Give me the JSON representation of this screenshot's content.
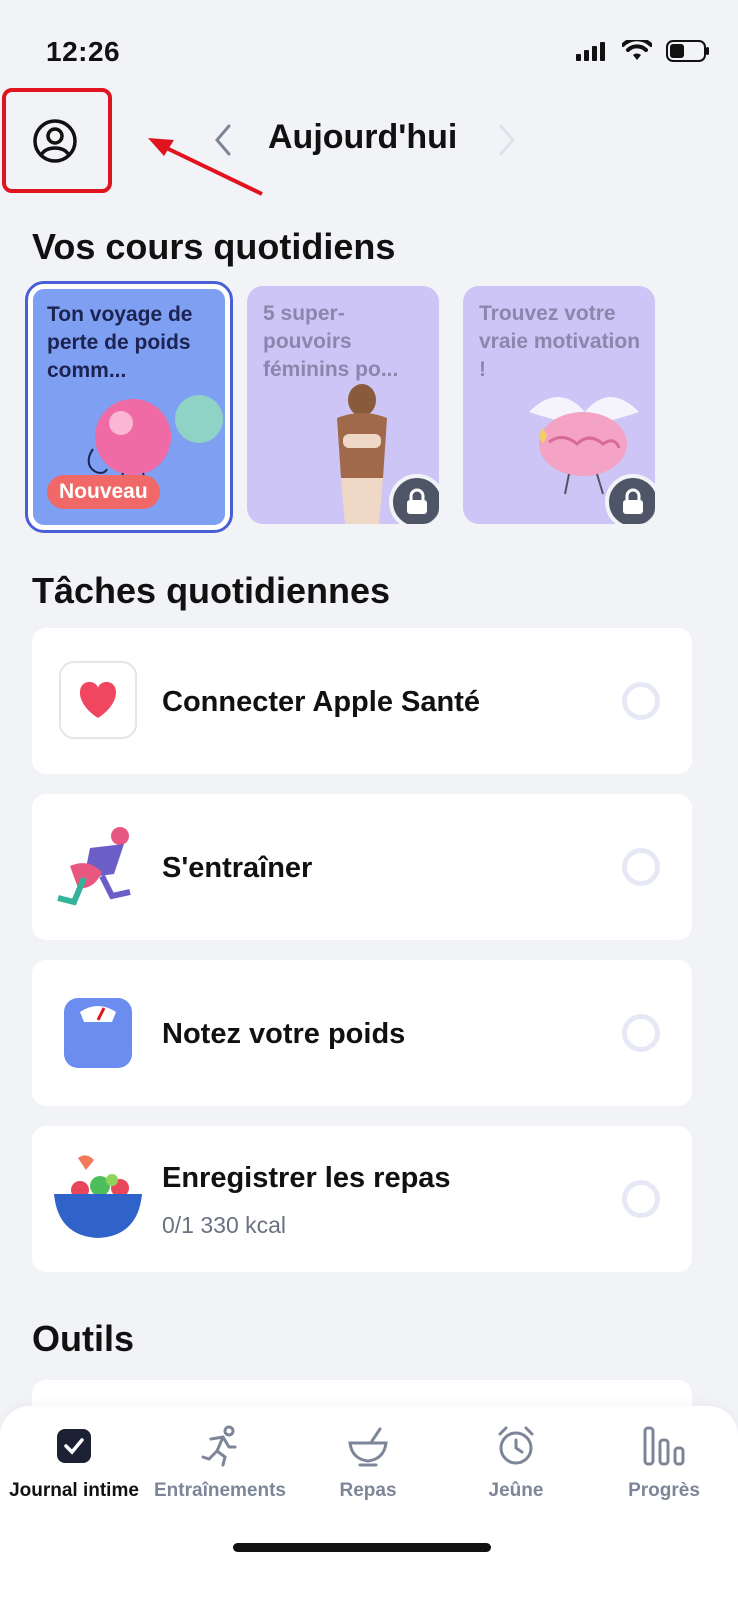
{
  "status_bar": {
    "time": "12:26"
  },
  "header": {
    "title": "Aujourd'hui"
  },
  "courses": {
    "section_title": "Vos cours quotidiens",
    "items": [
      {
        "title": "Ton voyage de perte de poids comm...",
        "badge": "Nouveau",
        "locked": false
      },
      {
        "title": "5 super-pouvoirs féminins po...",
        "locked": true
      },
      {
        "title": "Trouvez votre vraie motivation !",
        "locked": true
      }
    ]
  },
  "tasks": {
    "section_title": "Tâches quotidiennes",
    "items": [
      {
        "label": "Connecter Apple Santé",
        "icon": "heart-icon"
      },
      {
        "label": "S'entraîner",
        "icon": "runner-icon"
      },
      {
        "label": "Notez votre poids",
        "icon": "scale-icon"
      },
      {
        "label": "Enregistrer les repas",
        "sub": "0/1 330 kcal",
        "icon": "salad-bowl-icon"
      }
    ]
  },
  "tools": {
    "section_title": "Outils"
  },
  "tabbar": {
    "tabs": [
      {
        "label": "Journal intime",
        "icon": "journal-check-icon",
        "active": true
      },
      {
        "label": "Entraînements",
        "icon": "runner-icon"
      },
      {
        "label": "Repas",
        "icon": "bowl-icon"
      },
      {
        "label": "Jeûne",
        "icon": "alarm-clock-icon"
      },
      {
        "label": "Progrès",
        "icon": "bar-chart-icon"
      }
    ]
  },
  "colors": {
    "accent": "#4a5fd6",
    "annotation": "#e0141e",
    "card_active": "#7f9ff3",
    "card_locked": "#cdc5f5",
    "badge": "#f06868"
  }
}
